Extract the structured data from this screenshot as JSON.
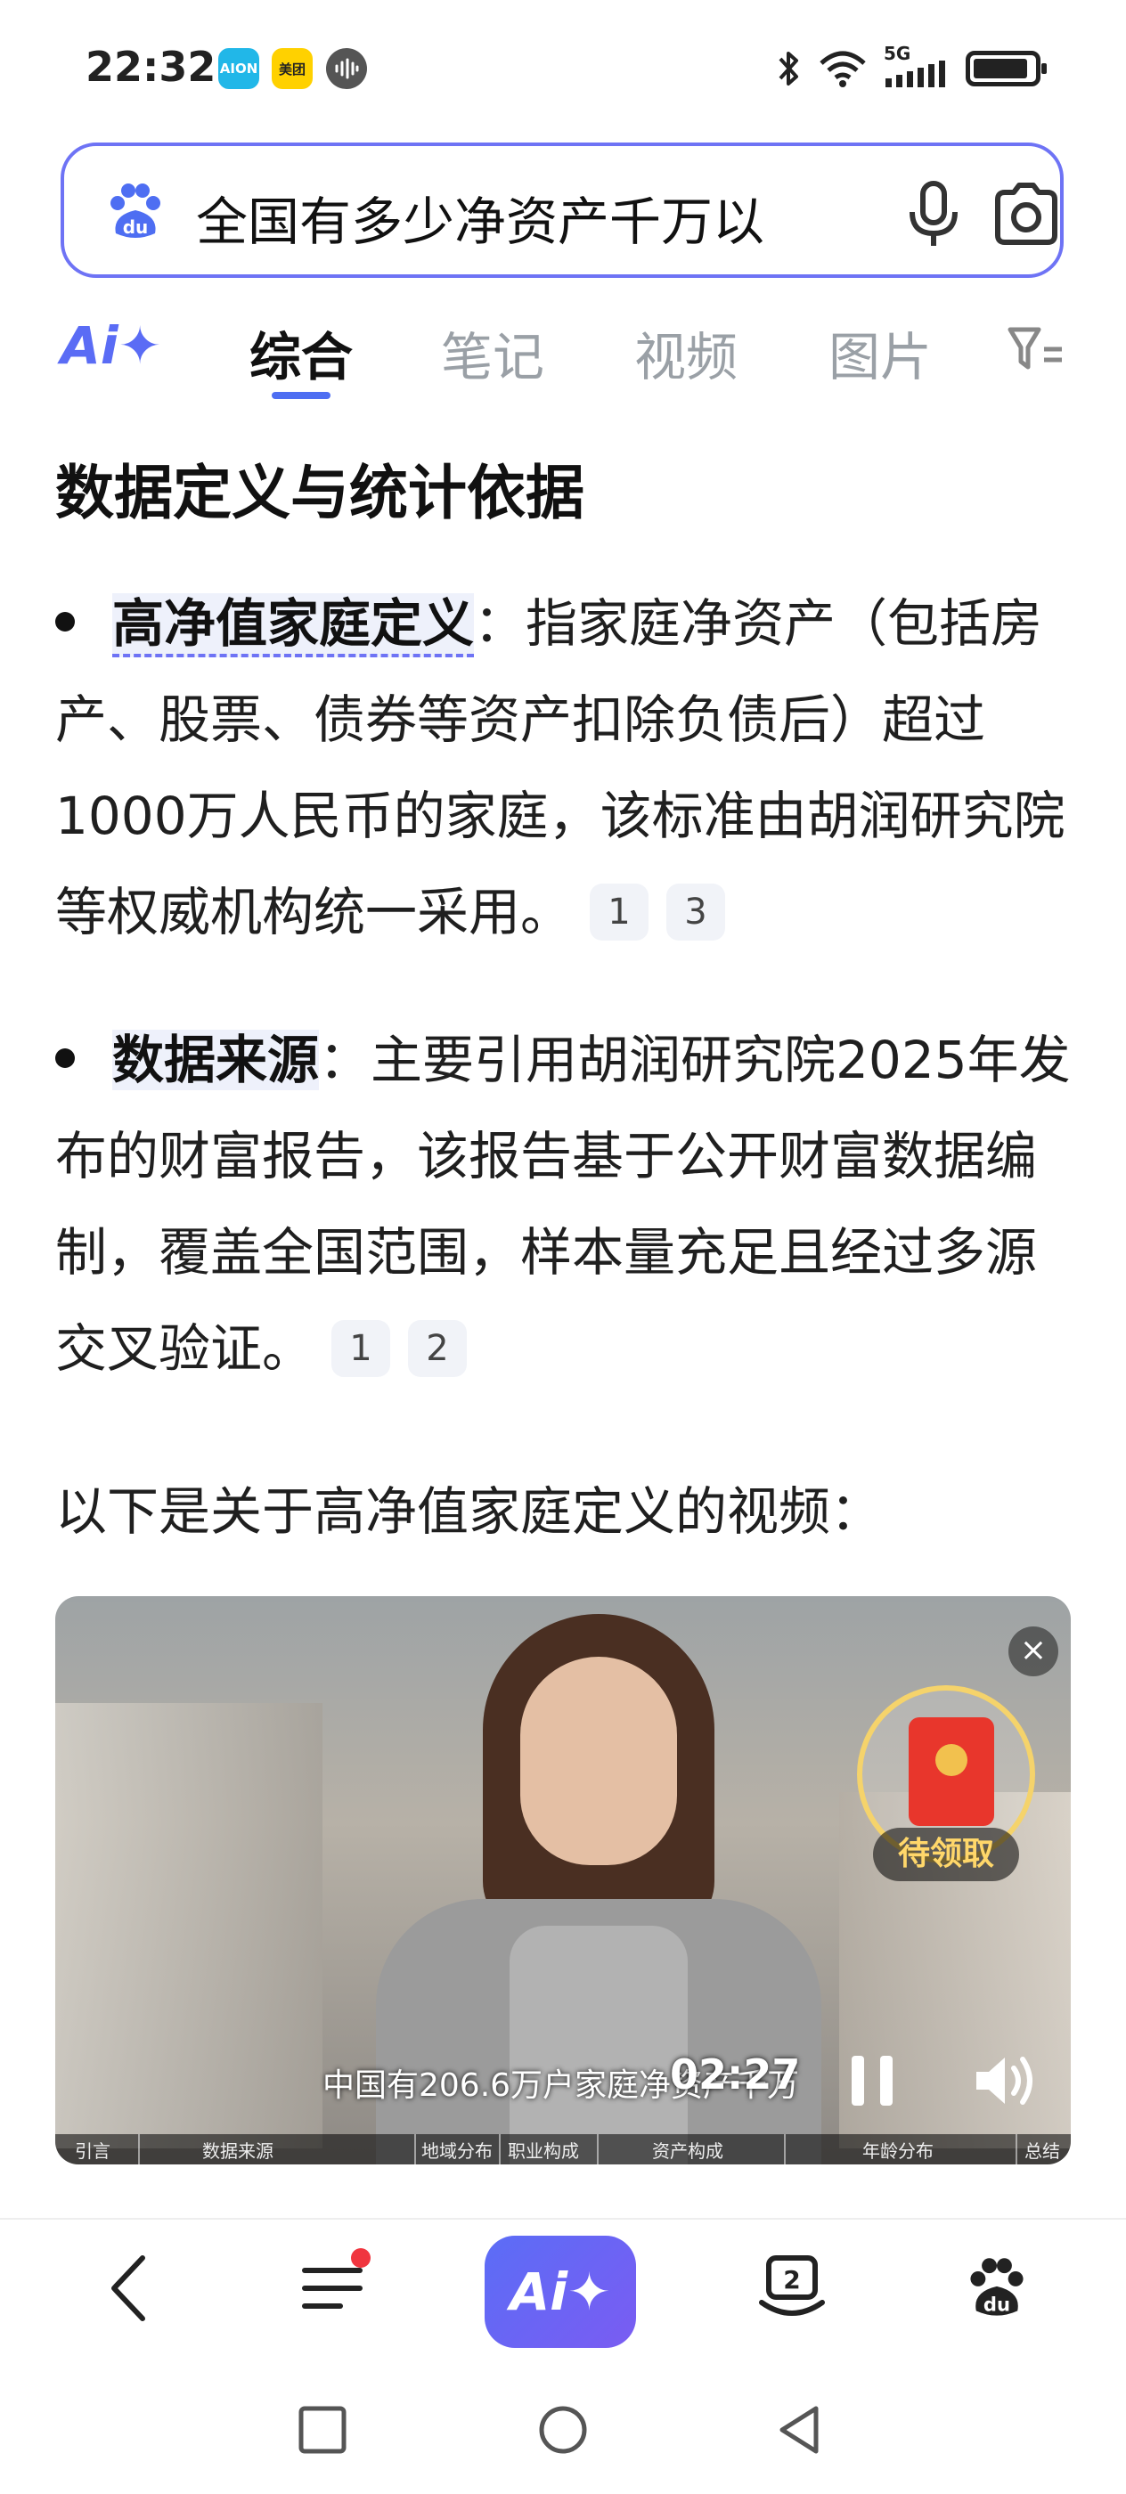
{
  "status_bar": {
    "time": "22:32",
    "apps": [
      "AION",
      "美团",
      "audio"
    ],
    "icons": [
      "bluetooth-icon",
      "wifi-icon",
      "signal-5g-icon",
      "battery-icon"
    ],
    "network": "5G"
  },
  "search": {
    "query": "全国有多少净资产千万以"
  },
  "tabs": {
    "ai_label": "Ai✦",
    "items": [
      "综合",
      "笔记",
      "视频",
      "图片"
    ],
    "active": "综合"
  },
  "content": {
    "section_title": "数据定义与统计依据",
    "bullets": [
      {
        "term": "高净值家庭定义",
        "text": "：指家庭净资产（包括房产、股票、债券等资产扣除负债后）超过1000万人民币的家庭，该标准由胡润研究院等权威机构统一采用。",
        "citations": [
          "1",
          "3"
        ]
      },
      {
        "term": "数据来源",
        "text": "：主要引用胡润研究院2025年发布的财富报告，该报告基于公开财富数据编制，覆盖全国范围，样本量充足且经过多源交叉验证。",
        "citations": [
          "1",
          "2"
        ]
      }
    ],
    "video_intro": "以下是关于高净值家庭定义的视频："
  },
  "video": {
    "subtitle": "中国有206.6万户家庭净资产千万",
    "timecode": "02:27",
    "red_packet_label": "待领取",
    "close_symbol": "×",
    "chapters": [
      "引言",
      "数据来源",
      "地域分布",
      "职业构成",
      "资产构成",
      "年龄分布",
      "总结"
    ]
  },
  "bottom_nav": {
    "ai_label": "Ai✦",
    "tab_count": "2"
  },
  "colors": {
    "accent": "#4e6ef2",
    "search_border": "#6e73f5",
    "ai_gradient_start": "#5b6df6",
    "ai_gradient_end": "#7a5cf2",
    "red_dot": "#f0353f"
  }
}
